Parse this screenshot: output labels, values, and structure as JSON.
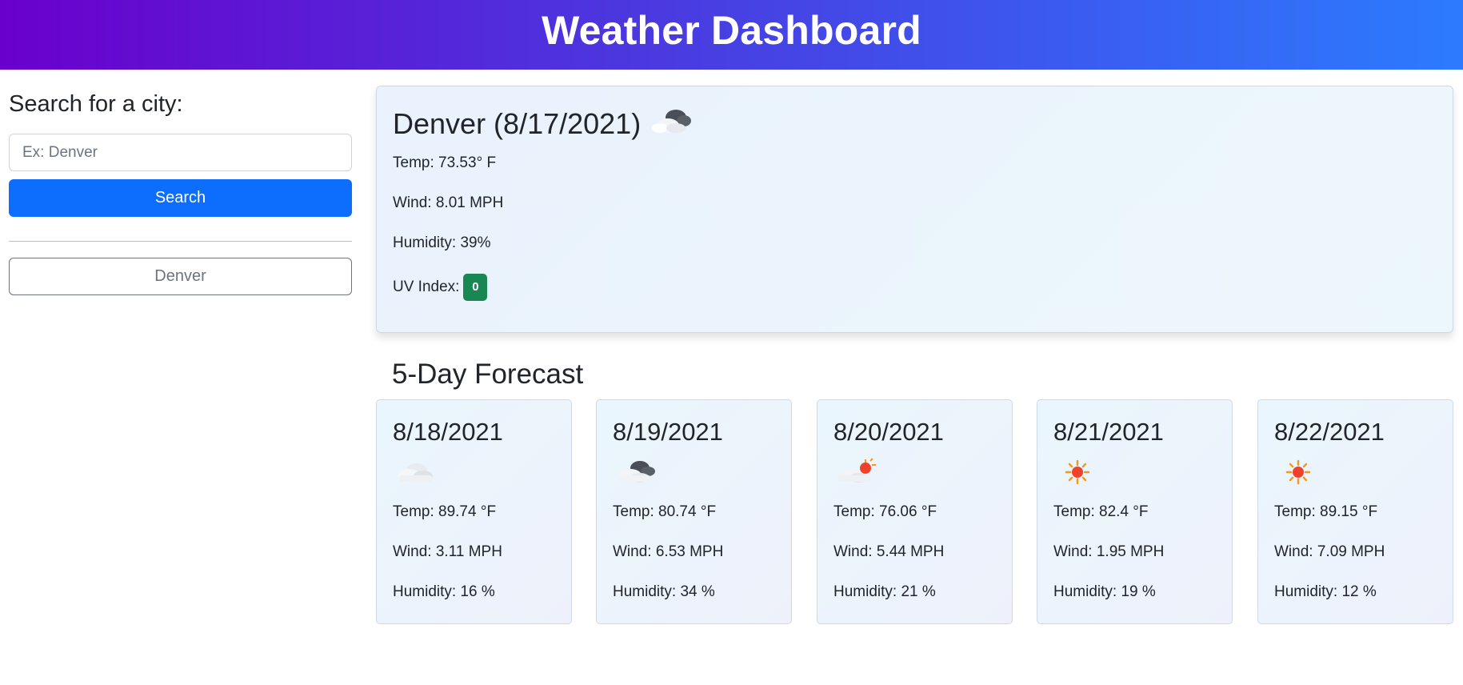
{
  "header": {
    "title": "Weather Dashboard"
  },
  "sidebar": {
    "search_label": "Search for a city:",
    "search_placeholder": "Ex: Denver",
    "search_button": "Search",
    "history": [
      "Denver"
    ]
  },
  "current": {
    "title": "Denver (8/17/2021)",
    "icon": "cloud-dark-icon",
    "temp": "Temp: 73.53° F",
    "wind": "Wind: 8.01 MPH",
    "humidity": "Humidity: 39%",
    "uv_label": "UV Index:",
    "uv_value": "0",
    "uv_color": "#198754"
  },
  "forecast": {
    "title": "5-Day Forecast",
    "days": [
      {
        "date": "8/18/2021",
        "icon": "cloud-icon",
        "temp": "Temp: 89.74 °F",
        "wind": "Wind: 3.11 MPH",
        "humidity": "Humidity: 16 %"
      },
      {
        "date": "8/19/2021",
        "icon": "cloud-dark-icon",
        "temp": "Temp: 80.74 °F",
        "wind": "Wind: 6.53 MPH",
        "humidity": "Humidity: 34 %"
      },
      {
        "date": "8/20/2021",
        "icon": "partly-sunny-icon",
        "temp": "Temp: 76.06 °F",
        "wind": "Wind: 5.44 MPH",
        "humidity": "Humidity: 21 %"
      },
      {
        "date": "8/21/2021",
        "icon": "sun-icon",
        "temp": "Temp: 82.4 °F",
        "wind": "Wind: 1.95 MPH",
        "humidity": "Humidity: 19 %"
      },
      {
        "date": "8/22/2021",
        "icon": "sun-icon",
        "temp": "Temp: 89.15 °F",
        "wind": "Wind: 7.09 MPH",
        "humidity": "Humidity: 12 %"
      }
    ]
  },
  "colors": {
    "primary": "#0d6efd",
    "header_start": "#6a00cc",
    "header_end": "#2c7bff"
  }
}
